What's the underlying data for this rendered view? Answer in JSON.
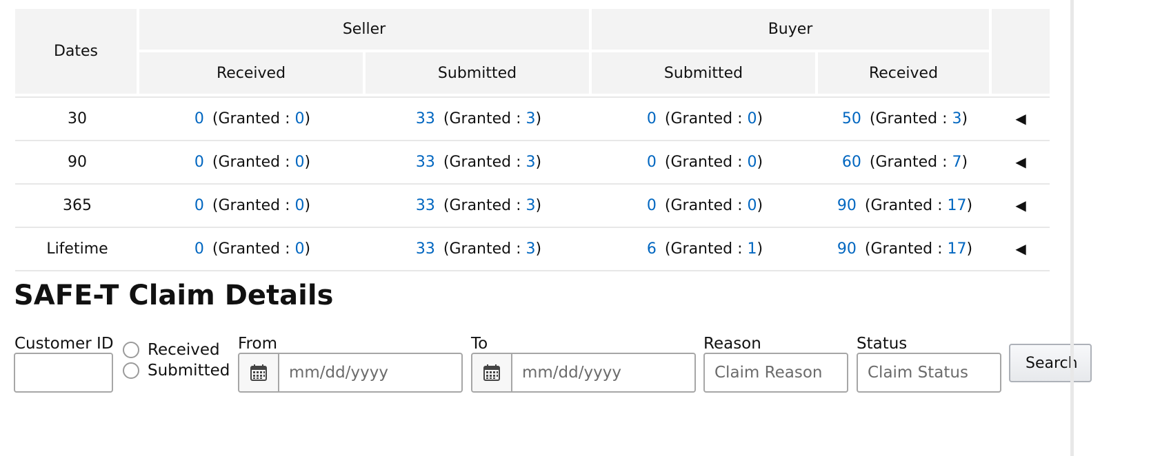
{
  "summary_table": {
    "header": {
      "dates": "Dates",
      "seller": "Seller",
      "buyer": "Buyer",
      "seller_received": "Received",
      "seller_submitted": "Submitted",
      "buyer_submitted": "Submitted",
      "buyer_received": "Received"
    },
    "granted_prefix": "(Granted : ",
    "granted_suffix": ")",
    "rows": [
      {
        "period": "30",
        "seller_received": "0",
        "seller_received_granted": "0",
        "seller_submitted": "33",
        "seller_submitted_granted": "3",
        "buyer_submitted": "0",
        "buyer_submitted_granted": "0",
        "buyer_received": "50",
        "buyer_received_granted": "3",
        "arrow": "◀"
      },
      {
        "period": "90",
        "seller_received": "0",
        "seller_received_granted": "0",
        "seller_submitted": "33",
        "seller_submitted_granted": "3",
        "buyer_submitted": "0",
        "buyer_submitted_granted": "0",
        "buyer_received": "60",
        "buyer_received_granted": "7",
        "arrow": "◀"
      },
      {
        "period": "365",
        "seller_received": "0",
        "seller_received_granted": "0",
        "seller_submitted": "33",
        "seller_submitted_granted": "3",
        "buyer_submitted": "0",
        "buyer_submitted_granted": "0",
        "buyer_received": "90",
        "buyer_received_granted": "17",
        "arrow": "◀"
      },
      {
        "period": "Lifetime",
        "seller_received": "0",
        "seller_received_granted": "0",
        "seller_submitted": "33",
        "seller_submitted_granted": "3",
        "buyer_submitted": "6",
        "buyer_submitted_granted": "1",
        "buyer_received": "90",
        "buyer_received_granted": "17",
        "arrow": "◀"
      }
    ]
  },
  "claim_details": {
    "title": "SAFE-T Claim Details",
    "customer_id_label": "Customer ID",
    "customer_id_value": "",
    "radio_received": "Received",
    "radio_submitted": "Submitted",
    "from_label": "From",
    "from_placeholder": "mm/dd/yyyy",
    "to_label": "To",
    "to_placeholder": "mm/dd/yyyy",
    "reason_label": "Reason",
    "reason_placeholder": "Claim Reason",
    "status_label": "Status",
    "status_placeholder": "Claim Status",
    "search_button": "Search"
  },
  "colors": {
    "link": "#0066c0",
    "header_bg": "#f3f3f3",
    "border": "#a6a6a6"
  },
  "icons": {
    "row_toggle": "caret-left-icon",
    "date_picker": "calendar-icon"
  }
}
